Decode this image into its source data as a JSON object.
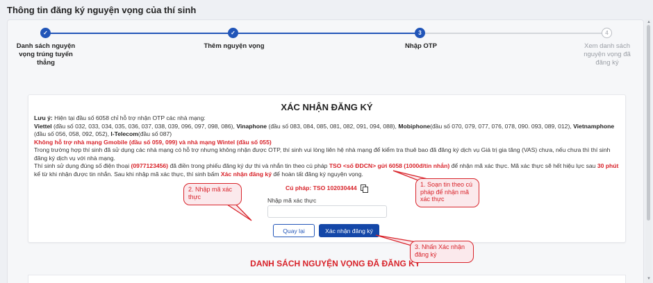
{
  "page": {
    "title": "Thông tin đăng ký nguyện vọng của thí sinh"
  },
  "stepper": {
    "steps": [
      {
        "number": "1",
        "label_lines": [
          "Danh sách nguyện",
          "vọng trúng tuyển",
          "thẳng"
        ],
        "status": "done"
      },
      {
        "number": "2",
        "label_lines": [
          "Thêm nguyện vọng"
        ],
        "status": "done"
      },
      {
        "number": "3",
        "label_lines": [
          "Nhập OTP"
        ],
        "status": "current"
      },
      {
        "number": "4",
        "label_lines": [
          "Xem danh sách",
          "nguyện vọng đã",
          "đăng ký"
        ],
        "status": "todo"
      }
    ]
  },
  "confirm": {
    "title": "XÁC NHẬN ĐĂNG KÝ",
    "note_label": "Lưu ý:",
    "note_intro": " Hiện tại đầu số 6058 chỉ hỗ trợ nhận OTP các nhà mạng:",
    "carriers": [
      {
        "name": "Viettel",
        "prefixes": " (đầu số 032, 033, 034, 035, 036, 037, 038, 039, 096, 097, 098, 086), "
      },
      {
        "name": "Vinaphone",
        "prefixes": " (đầu số 083, 084, 085, 081, 082, 091, 094, 088), "
      },
      {
        "name": "Mobiphone",
        "prefixes": "(đầu số 070, 079, 077, 076, 078, 090. 093, 089, 012), "
      },
      {
        "name": "Vietnamphone",
        "prefixes": " (đầu số 056, 058, 092, 052), "
      },
      {
        "name": "I-Telecom",
        "prefixes": "(đầu số 087)"
      }
    ],
    "unsupported": "Không hỗ trợ nhà mạng Gmobile (đầu số 059, 099) và nhà mạng Wintel (đầu số 055)",
    "para2": "Trong trường hợp thí sinh đã sử dụng các nhà mạng có hỗ trợ nhưng không nhận được OTP, thí sinh vui lòng liên hệ nhà mạng để kiểm tra thuê bao đã đăng ký dịch vụ Giá trị gia tăng (VAS) chưa, nếu chưa thì thí sinh đăng ký dịch vụ với nhà mạng.",
    "para3_a": "Thí sinh sử dụng đúng số điện thoại ",
    "phone": "(0977123456)",
    "para3_b": " đã điền trong phiếu đăng ký dự thi và nhắn tin theo cú pháp ",
    "sms_syntax": "TSO <số ĐDCN> gửi 6058 (1000đ/tin nhắn)",
    "para3_c": " để nhận mã xác thực. Mã xác thực sẽ hết hiệu lực sau ",
    "validity": "30 phút",
    "para3_d": " kể từ khi nhận được tin nhắn. Sau khi nhập mã xác thực, thí sinh bấm ",
    "confirm_ref": "Xác nhận đăng ký",
    "para3_e": " để hoàn tất đăng ký nguyện vọng.",
    "syntax_line": "Cú pháp: TSO 102030444",
    "copy_icon": "copy-icon",
    "field_label": "Nhập mã xác thực",
    "field_value": "",
    "field_placeholder": "",
    "back_button": "Quay lại",
    "confirm_button": "Xác nhận đăng ký"
  },
  "list_title": "DANH SÁCH NGUYỆN VỌNG ĐÃ ĐĂNG KÝ",
  "callouts": [
    {
      "id": "enter-code",
      "lines": [
        "2. Nhập mã xác",
        "thực"
      ]
    },
    {
      "id": "send-sms",
      "lines": [
        "1. Soạn tin theo cú",
        "pháp để nhận mã",
        "xác thực"
      ]
    },
    {
      "id": "press-confirm",
      "lines": [
        "3. Nhấn Xác nhận",
        "đăng ký"
      ]
    }
  ],
  "colors": {
    "primary": "#2155b8",
    "accent_red": "#d8232a",
    "callout_bg": "#fbe9ec"
  }
}
